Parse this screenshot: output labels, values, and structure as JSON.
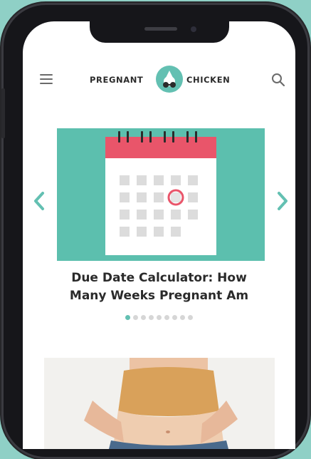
{
  "header": {
    "logo_left": "PREGNANT",
    "logo_right": "CHICKEN",
    "menu_icon": "menu-icon",
    "search_icon": "search-icon"
  },
  "carousel": {
    "slide_title": "Due Date Calculator: How\nMany Weeks Pregnant Am",
    "active_index": 0,
    "dot_count": 9
  },
  "colors": {
    "brand_teal": "#5cbfae",
    "calendar_red": "#e9556a",
    "background": "#8fd0c6"
  }
}
